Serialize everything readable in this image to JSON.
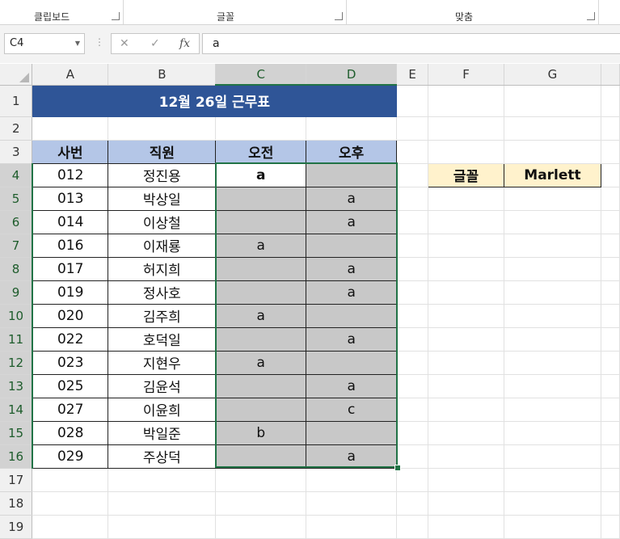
{
  "ribbon": {
    "groups": [
      "클립보드",
      "글꼴",
      "맞춤"
    ]
  },
  "formula_bar": {
    "name_box": "C4",
    "cancel_icon": "✕",
    "enter_icon": "✓",
    "fx_label": "fx",
    "content": "a"
  },
  "columns": [
    "A",
    "B",
    "C",
    "D",
    "E",
    "F",
    "G"
  ],
  "rows": [
    "1",
    "2",
    "3",
    "4",
    "5",
    "6",
    "7",
    "8",
    "9",
    "10",
    "11",
    "12",
    "13",
    "14",
    "15",
    "16",
    "17",
    "18",
    "19"
  ],
  "sheet": {
    "title": "12월 26일 근무표",
    "headers": [
      "사번",
      "직원",
      "오전",
      "오후"
    ],
    "records": [
      {
        "id": "012",
        "name": "정진용",
        "am": "a",
        "pm": ""
      },
      {
        "id": "013",
        "name": "박상일",
        "am": "",
        "pm": "a"
      },
      {
        "id": "014",
        "name": "이상철",
        "am": "",
        "pm": "a"
      },
      {
        "id": "016",
        "name": "이재룡",
        "am": "a",
        "pm": ""
      },
      {
        "id": "017",
        "name": "허지희",
        "am": "",
        "pm": "a"
      },
      {
        "id": "019",
        "name": "정사호",
        "am": "",
        "pm": "a"
      },
      {
        "id": "020",
        "name": "김주희",
        "am": "a",
        "pm": ""
      },
      {
        "id": "022",
        "name": "호덕일",
        "am": "",
        "pm": "a"
      },
      {
        "id": "023",
        "name": "지현우",
        "am": "a",
        "pm": ""
      },
      {
        "id": "025",
        "name": "김윤석",
        "am": "",
        "pm": "a"
      },
      {
        "id": "027",
        "name": "이윤희",
        "am": "",
        "pm": "c"
      },
      {
        "id": "028",
        "name": "박일준",
        "am": "b",
        "pm": ""
      },
      {
        "id": "029",
        "name": "주상덕",
        "am": "",
        "pm": "a"
      }
    ],
    "font_label": "글꼴",
    "font_value": "Marlett"
  },
  "colors": {
    "title_bg": "#2f5597",
    "header_bg": "#b4c6e7",
    "font_label_bg": "#fff2cc",
    "selection": "#217346",
    "cell_gray": "#c8c8c8"
  }
}
